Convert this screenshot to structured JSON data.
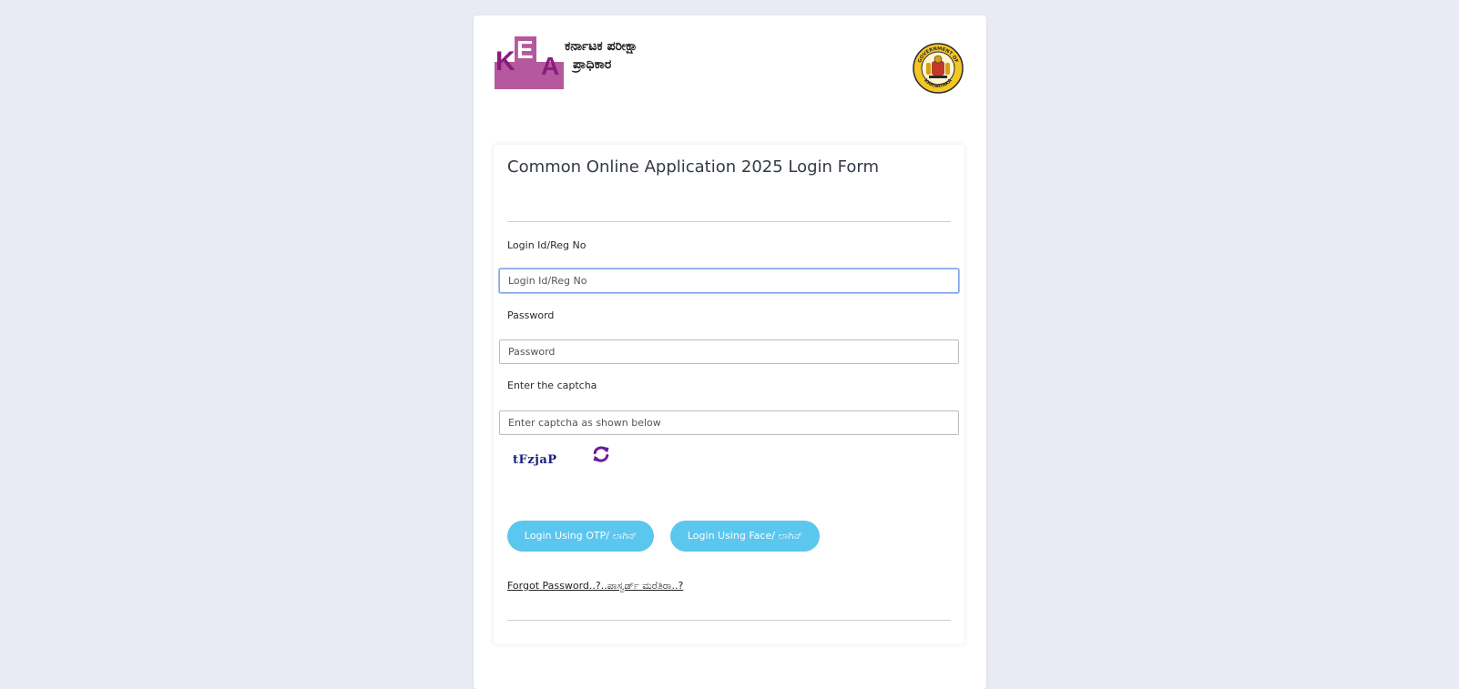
{
  "header": {
    "org_name_line1": "ಕರ್ನಾಟಕ ಪರೀಕ್ಷಾ",
    "org_name_line2": "ಪ್ರಾಧಿಕಾರ",
    "logo_letters": "KEA",
    "emblem_text_top": "GOVERNMENT OF",
    "emblem_text_bottom": "KARNATAKA"
  },
  "form": {
    "title": "Common Online Application 2025 Login Form",
    "login_label": "Login Id/Reg No",
    "login_placeholder": "Login Id/Reg No",
    "password_label": "Password",
    "password_placeholder": "Password",
    "captcha_label": "Enter the captcha",
    "captcha_placeholder": "Enter captcha as shown below",
    "captcha_value": "tFzjaP",
    "btn_otp": "Login Using OTP/ ಲಾಗಿನ್",
    "btn_face": "Login Using Face/ ಲಾಗಿನ್",
    "forgot_link": "Forgot Password..?..ಪಾಸ್ವರ್ಡ್ ಮರೆತಿರಾ..?"
  },
  "colors": {
    "background": "#e8ebf4",
    "button": "#5bc6ee",
    "kea_purple": "#8b1a7e",
    "kea_box": "#b5599e",
    "captcha": "#1a237e",
    "refresh_icon": "#6a1b9a"
  },
  "icons": {
    "refresh": "refresh-icon",
    "logo": "kea-logo",
    "emblem": "karnataka-emblem"
  }
}
